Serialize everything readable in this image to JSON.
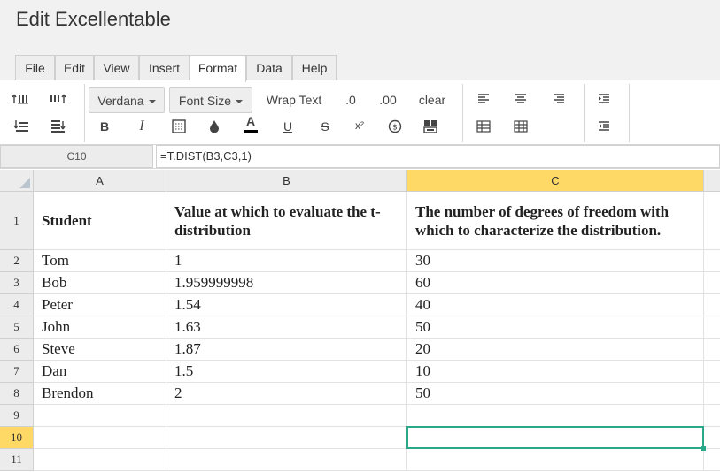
{
  "app": {
    "title": "Edit Excellentable"
  },
  "menu": {
    "items": [
      {
        "label": "File"
      },
      {
        "label": "Edit"
      },
      {
        "label": "View"
      },
      {
        "label": "Insert"
      },
      {
        "label": "Format",
        "active": true
      },
      {
        "label": "Data"
      },
      {
        "label": "Help"
      }
    ]
  },
  "toolbar": {
    "font_family": "Verdana",
    "font_size_label": "Font Size",
    "wrap_text_label": "Wrap Text",
    "decrease_decimal_label": ".0",
    "increase_decimal_label": ".00",
    "clear_label": "clear",
    "bold_label": "B",
    "italic_label": "I",
    "font_color_label": "A",
    "underline_label": "U",
    "strike_label": "S",
    "superscript_label": "x²",
    "font_color_accent": "#000000"
  },
  "formula_bar": {
    "cell_ref": "C10",
    "formula": "=T.DIST(B3,C3,1)"
  },
  "sheet": {
    "columns": [
      "A",
      "B",
      "C"
    ],
    "selected_column": "C",
    "selected_row": "10",
    "selection_color": "#2aa88a",
    "header_highlight": "#ffd966",
    "rows": [
      {
        "num": "1",
        "a": "Student",
        "b": "Value at which to evaluate the t-distribution",
        "c": "The number of degrees of freedom with which to characterize the distribution."
      },
      {
        "num": "2",
        "a": "Tom",
        "b": "1",
        "c": "30"
      },
      {
        "num": "3",
        "a": "Bob",
        "b": "1.959999998",
        "c": "60"
      },
      {
        "num": "4",
        "a": "Peter",
        "b": "1.54",
        "c": "40"
      },
      {
        "num": "5",
        "a": "John",
        "b": "1.63",
        "c": "50"
      },
      {
        "num": "6",
        "a": "Steve",
        "b": "1.87",
        "c": "20"
      },
      {
        "num": "7",
        "a": "Dan",
        "b": "1.5",
        "c": "10"
      },
      {
        "num": "8",
        "a": "Brendon",
        "b": "2",
        "c": "50"
      },
      {
        "num": "9",
        "a": "",
        "b": "",
        "c": ""
      },
      {
        "num": "10",
        "a": "",
        "b": "",
        "c": ""
      },
      {
        "num": "11",
        "a": "",
        "b": "",
        "c": ""
      }
    ]
  }
}
